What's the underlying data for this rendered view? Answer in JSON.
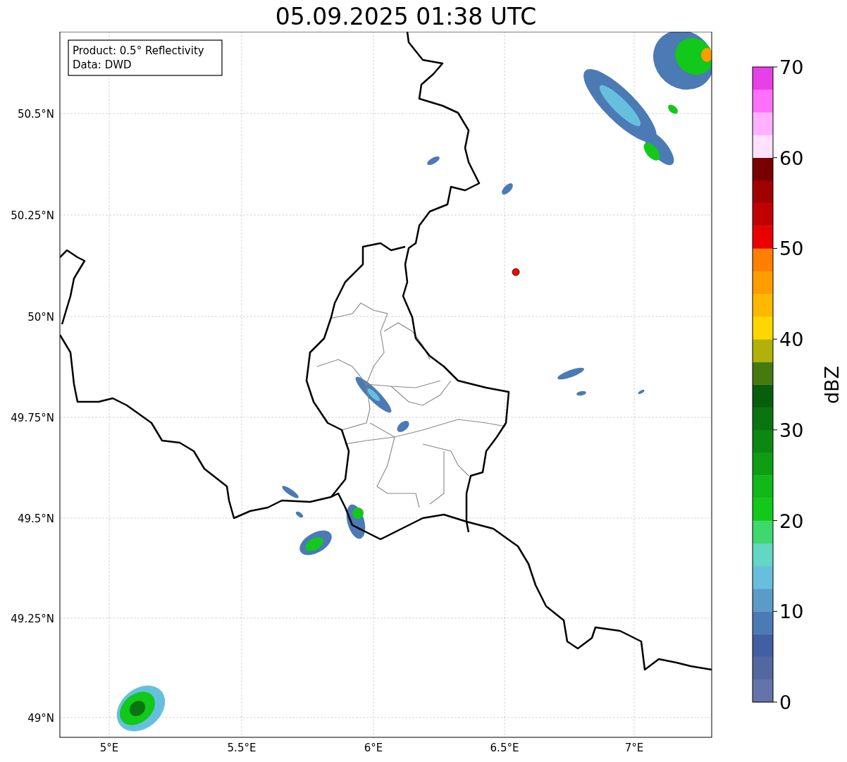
{
  "title": "05.09.2025 01:38 UTC",
  "info_box": [
    "Product: 0.5° Reflectivity",
    "Data: DWD"
  ],
  "lat_ticks": [
    "50.5°N",
    "50.25°N",
    "50°N",
    "49.75°N",
    "49.5°N",
    "49.25°N",
    "49°N"
  ],
  "lon_ticks": [
    "5°E",
    "5.5°E",
    "6°E",
    "6.5°E",
    "7°E"
  ],
  "colorbar": {
    "label": "dBZ",
    "ticks": [
      "70",
      "60",
      "50",
      "40",
      "30",
      "20",
      "10",
      "0"
    ],
    "bands": [
      {
        "color": "#6574a8"
      },
      {
        "color": "#5468a0"
      },
      {
        "color": "#435fa3"
      },
      {
        "color": "#4b7ab5"
      },
      {
        "color": "#5a9bc8"
      },
      {
        "color": "#66c0dd"
      },
      {
        "color": "#63d6c4"
      },
      {
        "color": "#3ed86c"
      },
      {
        "color": "#12c81a"
      },
      {
        "color": "#10b818"
      },
      {
        "color": "#0e9e14"
      },
      {
        "color": "#0c8812"
      },
      {
        "color": "#0a7410"
      },
      {
        "color": "#075e0c"
      },
      {
        "color": "#467a0e"
      },
      {
        "color": "#b1b10a"
      },
      {
        "color": "#ffd700"
      },
      {
        "color": "#ffb800"
      },
      {
        "color": "#ff9c00"
      },
      {
        "color": "#ff7f00"
      },
      {
        "color": "#e80000"
      },
      {
        "color": "#c00000"
      },
      {
        "color": "#a00000"
      },
      {
        "color": "#780000"
      },
      {
        "color": "#ffe0ff"
      },
      {
        "color": "#ffb0ff"
      },
      {
        "color": "#ff70ff"
      },
      {
        "color": "#e840e8"
      }
    ]
  }
}
